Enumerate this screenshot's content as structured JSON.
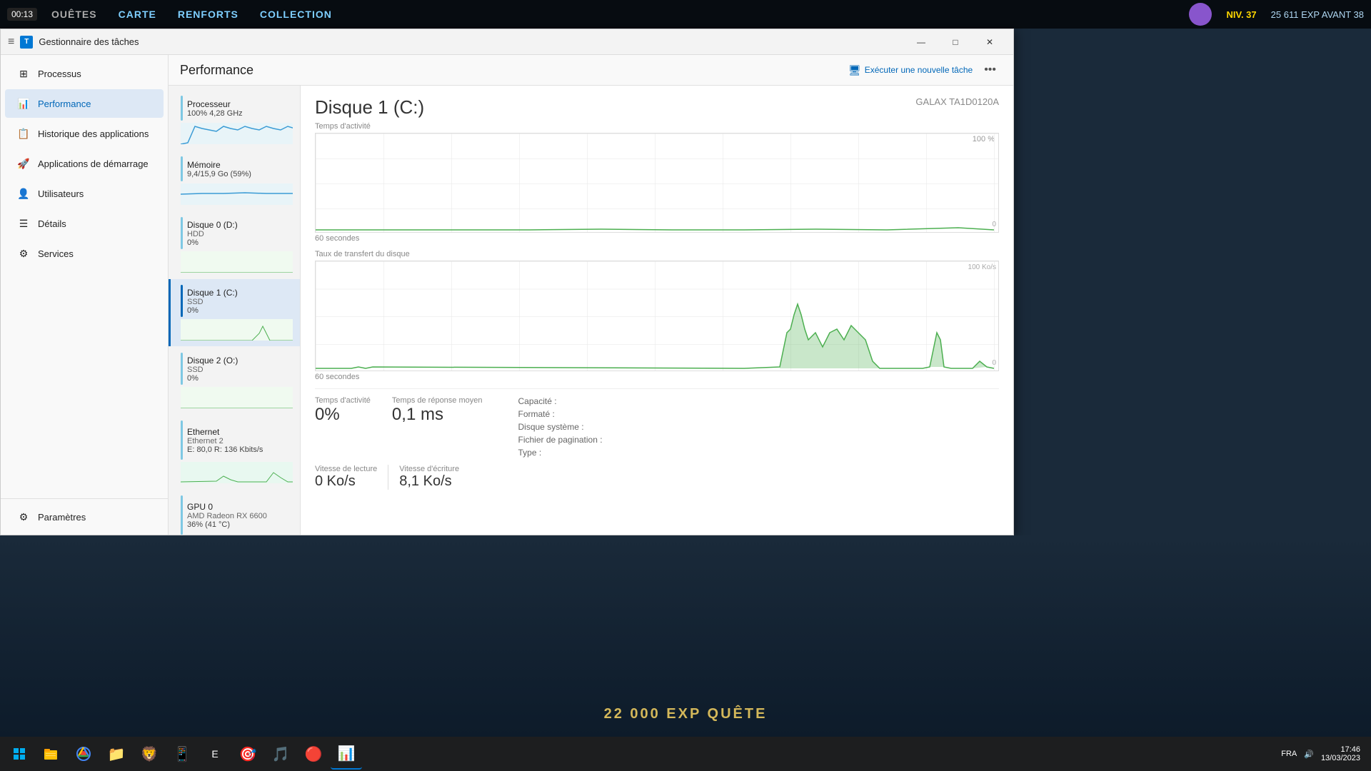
{
  "game": {
    "time": "00:13",
    "nav": {
      "items": [
        {
          "label": "OUÊTES",
          "active": false
        },
        {
          "label": "CARTE",
          "active": false
        },
        {
          "label": "RENFORTS",
          "active": false
        },
        {
          "label": "COLLECTION",
          "active": false
        }
      ]
    },
    "level": "NIV. 37",
    "exp_before": "25 611 EXP AVANT 38",
    "xp_quest": "22 000 EXP  QUÊTE"
  },
  "taskmanager": {
    "title": "Gestionnaire des tâches",
    "header": {
      "menu_icon": "≡",
      "app_icon_text": "T"
    },
    "window_controls": {
      "minimize": "—",
      "maximize": "□",
      "close": "✕"
    },
    "sidebar": {
      "items": [
        {
          "label": "Processus",
          "icon": "⊞",
          "active": false
        },
        {
          "label": "Performance",
          "icon": "📊",
          "active": true
        },
        {
          "label": "Historique des applications",
          "icon": "📋",
          "active": false
        },
        {
          "label": "Applications de démarrage",
          "icon": "🚀",
          "active": false
        },
        {
          "label": "Utilisateurs",
          "icon": "👤",
          "active": false
        },
        {
          "label": "Détails",
          "icon": "☰",
          "active": false
        },
        {
          "label": "Services",
          "icon": "⚙",
          "active": false
        }
      ],
      "bottom": {
        "label": "Paramètres",
        "icon": "⚙"
      }
    },
    "main": {
      "page_title": "Performance",
      "new_task_label": "Exécuter une nouvelle tâche",
      "more_options": "•••"
    },
    "devices": [
      {
        "name": "Processeur",
        "type": "",
        "usage": "100% 4,28 GHz",
        "active": false
      },
      {
        "name": "Mémoire",
        "type": "",
        "usage": "9,4/15,9 Go (59%)",
        "active": false
      },
      {
        "name": "Disque 0 (D:)",
        "type": "HDD",
        "usage": "0%",
        "active": false
      },
      {
        "name": "Disque 1 (C:)",
        "type": "SSD",
        "usage": "0%",
        "active": true
      },
      {
        "name": "Disque 2 (O:)",
        "type": "SSD",
        "usage": "0%",
        "active": false
      },
      {
        "name": "Ethernet",
        "type": "Ethernet 2",
        "usage": "E: 80,0  R: 136 Kbits/s",
        "active": false
      },
      {
        "name": "GPU 0",
        "type": "AMD Radeon RX 6600",
        "usage": "36% (41 °C)",
        "active": false
      }
    ],
    "detail": {
      "title": "Disque 1 (C:)",
      "subtitle": "GALAX TA1D0120A",
      "activity_label": "Temps d'activité",
      "activity_percent": "100 %",
      "time_label": "60 secondes",
      "transfer_label": "Taux de transfert du disque",
      "transfer_time": "60 secondes",
      "transfer_max": "100 Ko/s",
      "transfer_zero": "0",
      "activity_zero": "0",
      "stats": {
        "activity": {
          "label": "Temps d'activité",
          "value": "0%"
        },
        "response": {
          "label": "Temps de réponse moyen",
          "value": "0,1 ms"
        },
        "capacity": {
          "label": "Capacité :",
          "value": ""
        },
        "formatted": {
          "label": "Formaté :",
          "value": ""
        },
        "system_disk": {
          "label": "Disque système :",
          "value": ""
        },
        "paging_file": {
          "label": "Fichier de pagination :",
          "value": ""
        },
        "type": {
          "label": "Type :",
          "value": ""
        }
      },
      "speeds": {
        "read": {
          "label": "Vitesse de lecture",
          "value": "0 Ko/s"
        },
        "write": {
          "label": "Vitesse d'écriture",
          "value": "8,1 Ko/s"
        }
      }
    }
  },
  "taskbar": {
    "time": "17:46",
    "date": "13/03/2023",
    "language": "FRA",
    "icons": [
      "⊞",
      "🗂",
      "🌐",
      "📁",
      "🦁",
      "📱",
      "🎮",
      "🎯",
      "🎵",
      "🔴",
      "📊"
    ]
  }
}
